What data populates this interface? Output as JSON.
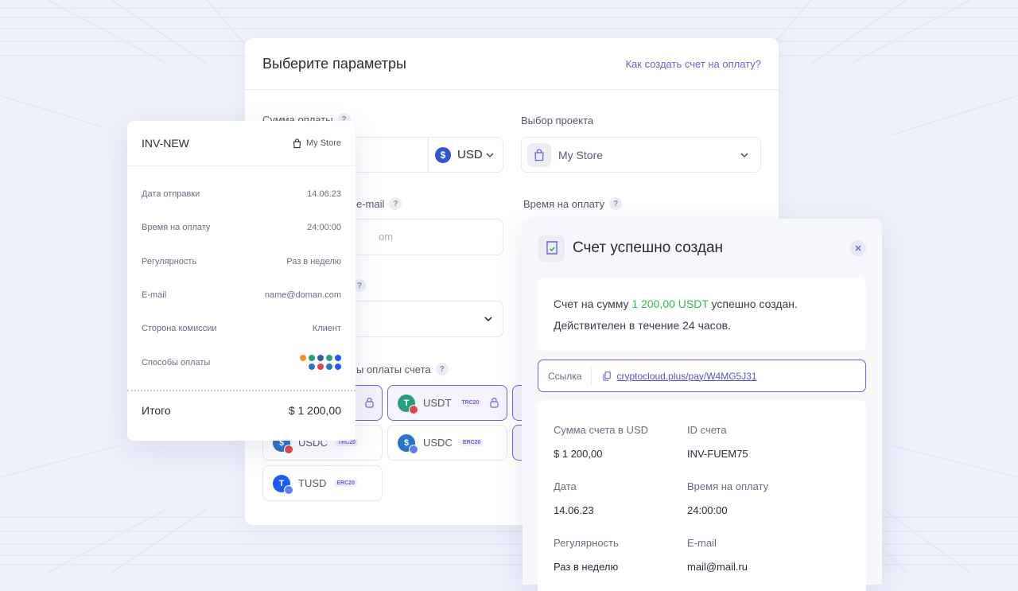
{
  "params": {
    "title": "Выберите параметры",
    "help_link": "Как создать счет на оплату?",
    "amount_label": "Сумма оплаты",
    "currency": "USD",
    "project_label": "Выбор проекта",
    "project_value": "My Store",
    "email_label_partial": "e-mail",
    "email_value_partial": "om",
    "time_label": "Время на оплату",
    "methods_label_partial": "ы оплаты счета",
    "methods": [
      {
        "name": "USDT",
        "network": "TRC20",
        "selected": true,
        "locked": true
      },
      {
        "name": "USDC",
        "network": "TRC20",
        "selected": false,
        "locked": false
      },
      {
        "name": "USDC",
        "network": "ERC20",
        "selected": false,
        "locked": false
      },
      {
        "name": "TUSD",
        "network": "ERC20",
        "selected": false,
        "locked": false
      }
    ]
  },
  "invoice": {
    "id": "INV-NEW",
    "store": "My Store",
    "rows": [
      {
        "label": "Дата отправки",
        "value": "14.06.23"
      },
      {
        "label": "Время на оплату",
        "value": "24:00:00"
      },
      {
        "label": "Регулярность",
        "value": "Раз в неделю"
      },
      {
        "label": "E-mail",
        "value": "name@doman.com"
      },
      {
        "label": "Сторона комиссии",
        "value": "Клиент"
      },
      {
        "label": "Способы оплаты",
        "value": ""
      }
    ],
    "total_label": "Итого",
    "total_value": "$ 1 200,00"
  },
  "success": {
    "title": "Счет успешно создан",
    "msg_before": "Счет на сумму ",
    "msg_amount": "1 200,00 USDT",
    "msg_after": " успешно создан. Действителен в течение 24 часов.",
    "link_label": "Ссылка",
    "link_url": "cryptocloud.plus/pay/W4MG5J31",
    "details": [
      {
        "label": "Сумма счета в USD",
        "value": "$ 1 200,00"
      },
      {
        "label": "ID счета",
        "value": "INV-FUEM75"
      },
      {
        "label": "Дата",
        "value": "14.06.23"
      },
      {
        "label": "Время на оплату",
        "value": "24:00:00"
      },
      {
        "label": "Регулярность",
        "value": "Раз в неделю"
      },
      {
        "label": "E-mail",
        "value": "mail@mail.ru"
      }
    ]
  },
  "colors": {
    "accent": "#6e63d8",
    "success_green": "#34b35a",
    "background": "#eef1fb"
  }
}
